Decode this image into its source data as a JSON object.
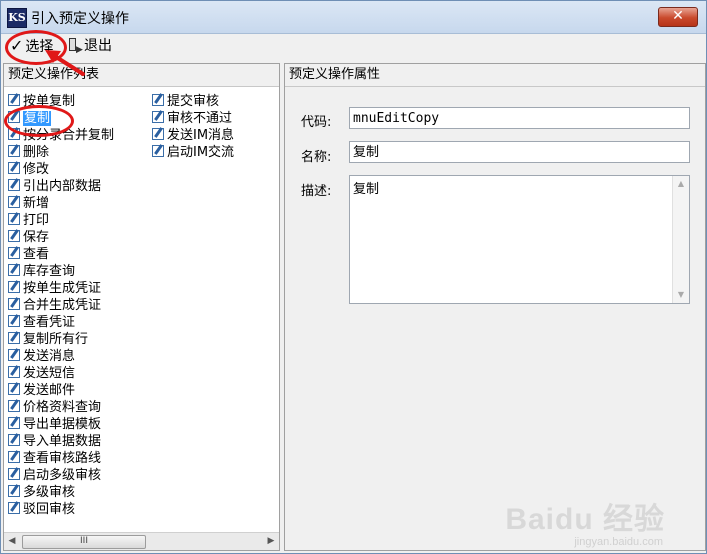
{
  "window": {
    "app_icon_text": "KS",
    "title": "引入预定义操作",
    "close_glyph": "✕"
  },
  "toolbar": {
    "select_label": "选择",
    "select_icon": "check-icon",
    "exit_label": "退出",
    "exit_icon": "exit-door-icon"
  },
  "left_panel": {
    "header": "预定义操作列表",
    "column1": [
      "按单复制",
      "复制",
      "按分录合并复制",
      "删除",
      "修改",
      "引出内部数据",
      "新增",
      "打印",
      "保存",
      "查看",
      "库存查询",
      "按单生成凭证",
      "合并生成凭证",
      "查看凭证",
      "复制所有行",
      "发送消息",
      "发送短信",
      "发送邮件",
      "价格资料查询",
      "导出单据模板",
      "导入单据数据",
      "查看审核路线",
      "启动多级审核",
      "多级审核",
      "驳回审核"
    ],
    "column2": [
      "提交审核",
      "审核不通过",
      "发送IM消息",
      "启动IM交流"
    ],
    "selected_item": "复制",
    "scroll_thumb_glyph": "III",
    "scroll_left_glyph": "◀",
    "scroll_right_glyph": "▶"
  },
  "right_panel": {
    "header": "预定义操作属性",
    "code_label": "代码:",
    "code_value": "mnuEditCopy",
    "name_label": "名称:",
    "name_value": "复制",
    "desc_label": "描述:",
    "desc_value": "复制",
    "scroll_up_glyph": "▲",
    "scroll_down_glyph": "▼"
  },
  "watermark": {
    "brand": "Baidu 经验",
    "url": "jingyan.baidu.com"
  },
  "colors": {
    "selection": "#3399ff",
    "annotation": "#e01818",
    "titlebar": "#dbe7f5"
  }
}
